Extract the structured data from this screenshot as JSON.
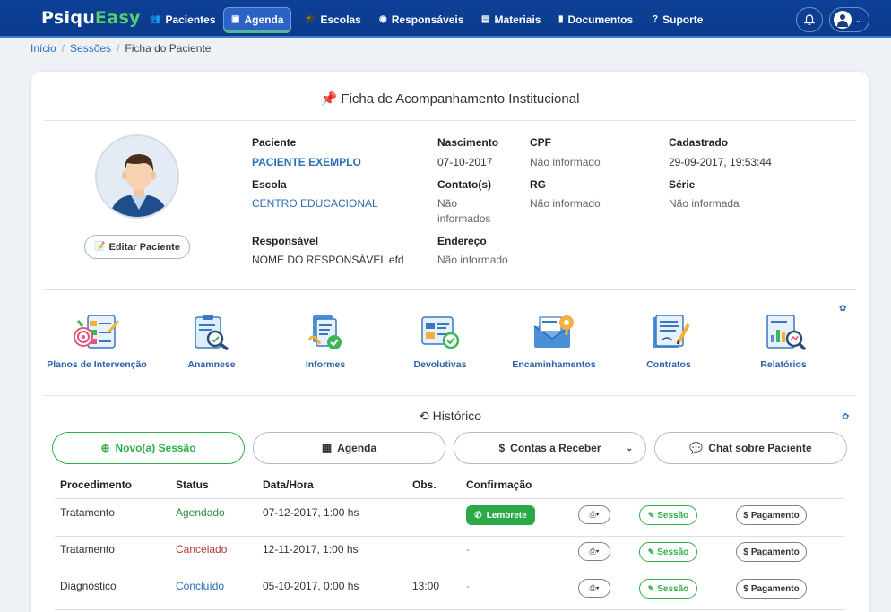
{
  "brand": {
    "part1": "Psiqu",
    "part2": "Easy"
  },
  "nav": [
    {
      "label": "Pacientes",
      "icon": "users-icon",
      "glyph": "👥"
    },
    {
      "label": "Agenda",
      "icon": "calendar-icon",
      "glyph": "📇"
    },
    {
      "label": "Escolas",
      "icon": "graduation-cap-icon",
      "glyph": "🎓"
    },
    {
      "label": "Responsáveis",
      "icon": "user-circle-icon",
      "glyph": "◉"
    },
    {
      "label": "Materiais",
      "icon": "file-icon",
      "glyph": "▤"
    },
    {
      "label": "Documentos",
      "icon": "book-icon",
      "glyph": "▮"
    },
    {
      "label": "Suporte",
      "icon": "question-circle-icon",
      "glyph": "?"
    }
  ],
  "breadcrumb": {
    "home": "Início",
    "sessions": "Sessões",
    "current": "Ficha do Paciente"
  },
  "card": {
    "title_icon": "📌",
    "title": "Ficha de Acompanhamento Institucional",
    "edit_button": "Editar Paciente",
    "edit_icon": "📝",
    "fields": {
      "paciente": {
        "label": "Paciente",
        "value": "PACIENTE EXEMPLO"
      },
      "nascimento": {
        "label": "Nascimento",
        "value": "07-10-2017"
      },
      "cpf": {
        "label": "CPF",
        "value": "Não informado"
      },
      "cadastrado": {
        "label": "Cadastrado",
        "value": "29-09-2017, 19:53:44"
      },
      "escola": {
        "label": "Escola",
        "value": "CENTRO EDUCACIONAL"
      },
      "contato": {
        "label": "Contato(s)",
        "value_line1": "Não",
        "value_line2": "informados"
      },
      "rg": {
        "label": "RG",
        "value": "Não informado"
      },
      "serie": {
        "label": "Série",
        "value": "Não informada"
      },
      "responsavel": {
        "label": "Responsável",
        "value": "NOME DO RESPONSÁVEL efd"
      },
      "endereco": {
        "label": "Endereço",
        "value": "Não informado"
      }
    },
    "tools": [
      {
        "label": "Planos de Intervenção",
        "icon": "intervention-plan-icon"
      },
      {
        "label": "Anamnese",
        "icon": "anamnesis-icon"
      },
      {
        "label": "Informes",
        "icon": "reports-doc-icon"
      },
      {
        "label": "Devolutivas",
        "icon": "feedback-icon"
      },
      {
        "label": "Encaminhamentos",
        "icon": "referral-icon"
      },
      {
        "label": "Contratos",
        "icon": "contract-icon"
      },
      {
        "label": "Relatórios",
        "icon": "analytics-icon"
      }
    ],
    "history": {
      "title_icon": "⟲",
      "title": "Histórico",
      "buttons": {
        "new_session": "Novo(a) Sessão",
        "agenda": "Agenda",
        "receivables": "Contas a Receber",
        "chat": "Chat sobre Paciente"
      },
      "columns": [
        "Procedimento",
        "Status",
        "Data/Hora",
        "Obs.",
        "Confirmação"
      ],
      "rows": [
        {
          "procedure": "Tratamento",
          "status": "Agendado",
          "datetime": "07-12-2017, 1:00 hs",
          "obs": "",
          "confirmation": "Lembrete",
          "session": "Sessão",
          "payment": "Pagamento"
        },
        {
          "procedure": "Tratamento",
          "status": "Cancelado",
          "datetime": "12-11-2017, 1:00 hs",
          "obs": "",
          "confirmation": "-",
          "session": "Sessão",
          "payment": "Pagamento"
        },
        {
          "procedure": "Diagnóstico",
          "status": "Concluído",
          "datetime": "05-10-2017, 0:00 hs",
          "obs": "13:00",
          "confirmation": "-",
          "session": "Sessão",
          "payment": "Pagamento"
        }
      ]
    }
  },
  "colors": {
    "navbar": "#0b3d91",
    "brand_green": "#57d06a",
    "link": "#2c6db3",
    "success": "#2fae4a"
  }
}
